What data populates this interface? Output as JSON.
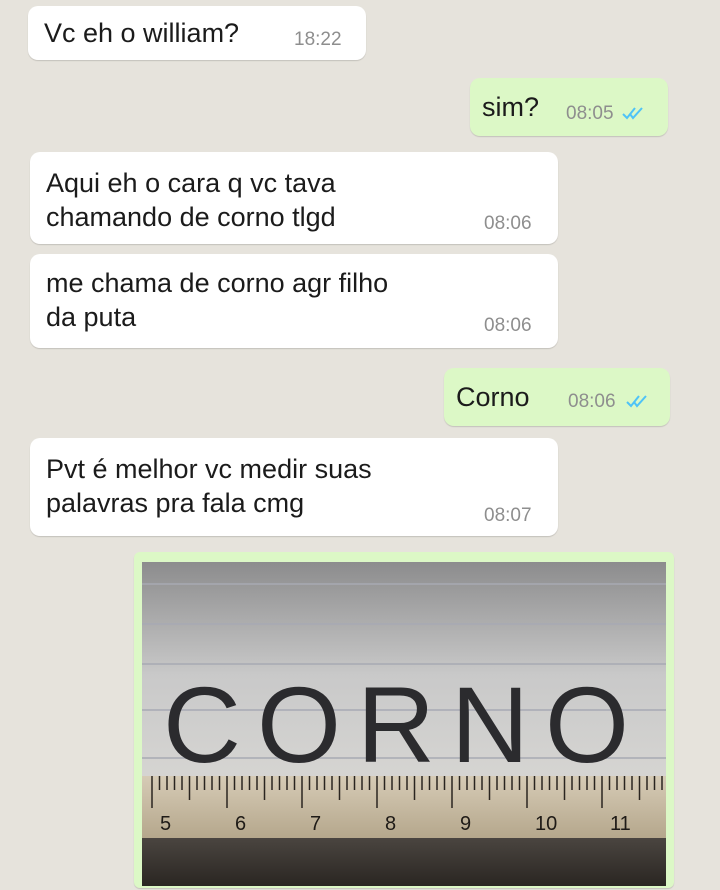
{
  "messages": [
    {
      "id": "m1",
      "direction": "incoming",
      "text": "Vc eh o william?",
      "time": "18:22"
    },
    {
      "id": "m2",
      "direction": "outgoing",
      "text": "sim?",
      "time": "08:05",
      "status": "read-ticks-icon"
    },
    {
      "id": "m3",
      "direction": "incoming",
      "text": "Aqui eh o cara q vc tava\nchamando de corno tlgd",
      "time": "08:06"
    },
    {
      "id": "m4",
      "direction": "incoming",
      "text": "me chama de corno agr filho\nda puta",
      "time": "08:06"
    },
    {
      "id": "m5",
      "direction": "outgoing",
      "text": "Corno",
      "time": "08:06",
      "status": "read-ticks-icon"
    },
    {
      "id": "m6",
      "direction": "incoming",
      "text": "Pvt é melhor vc medir suas\npalavras pra fala cmg",
      "time": "08:07"
    }
  ],
  "photo": {
    "handwritten_word": "CORNO",
    "ruler_numbers": [
      "5",
      "6",
      "7",
      "8",
      "9",
      "10",
      "11"
    ]
  },
  "colors": {
    "background": "#e6e3dc",
    "incoming_bubble": "#ffffff",
    "outgoing_bubble": "#dcf8c6",
    "read_ticks": "#4fc3f7"
  }
}
